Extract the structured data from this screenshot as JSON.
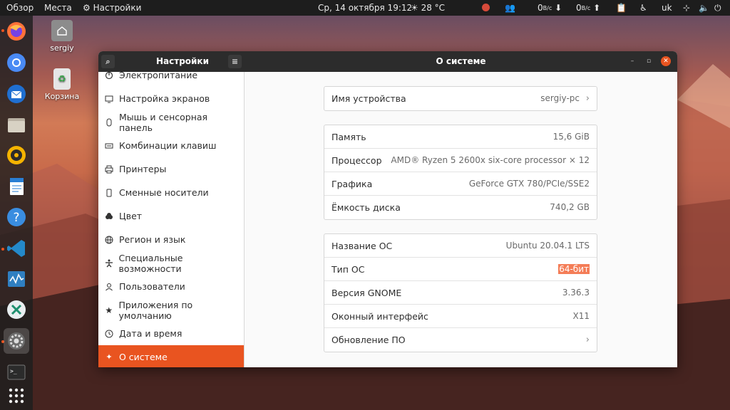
{
  "topbar": {
    "activities": "Обзор",
    "places": "Места",
    "app_menu": "Настройки",
    "datetime": "Ср, 14 октября  19:12",
    "weather": "28 °C",
    "net_down_value": "0",
    "net_up_value": "0",
    "net_unit": "B/c",
    "keyboard_layout": "uk"
  },
  "desktop": {
    "home_label": "sergiy",
    "trash_label": "Корзина"
  },
  "window": {
    "sidebar_title": "Настройки",
    "main_title": "О системе"
  },
  "sidebar": {
    "items": [
      {
        "label": "Электропитание",
        "icon": "power-icon"
      },
      {
        "label": "Настройка экранов",
        "icon": "display-icon"
      },
      {
        "label": "Мышь и сенсорная панель",
        "icon": "mouse-icon"
      },
      {
        "label": "Комбинации клавиш",
        "icon": "keyboard-icon"
      },
      {
        "label": "Принтеры",
        "icon": "printer-icon"
      },
      {
        "label": "Сменные носители",
        "icon": "removable-media-icon"
      },
      {
        "label": "Цвет",
        "icon": "color-icon"
      },
      {
        "label": "Регион и язык",
        "icon": "globe-icon"
      },
      {
        "label": "Специальные возможности",
        "icon": "accessibility-icon"
      },
      {
        "label": "Пользователи",
        "icon": "user-icon"
      },
      {
        "label": "Приложения по умолчанию",
        "icon": "star-icon"
      },
      {
        "label": "Дата и время",
        "icon": "clock-icon"
      },
      {
        "label": "О системе",
        "icon": "sparkle-icon",
        "selected": true
      }
    ]
  },
  "about": {
    "device": {
      "label": "Имя устройства",
      "value": "sergiy-pc"
    },
    "hardware": [
      {
        "label": "Память",
        "value": "15,6 GiB"
      },
      {
        "label": "Процессор",
        "value": "AMD® Ryzen 5 2600x six-core processor × 12"
      },
      {
        "label": "Графика",
        "value": "GeForce GTX 780/PCIe/SSE2"
      },
      {
        "label": "Ёмкость диска",
        "value": "740,2 GB"
      }
    ],
    "software": [
      {
        "label": "Название ОС",
        "value": "Ubuntu 20.04.1 LTS"
      },
      {
        "label": "Тип ОС",
        "value": "64-бит"
      },
      {
        "label": "Версия GNOME",
        "value": "3.36.3"
      },
      {
        "label": "Оконный интерфейс",
        "value": "X11"
      },
      {
        "label": "Обновление ПО",
        "value": ""
      }
    ]
  },
  "colors": {
    "accent": "#e95420",
    "highlight": "#f47d57",
    "titlebar": "#2c2c2c"
  }
}
